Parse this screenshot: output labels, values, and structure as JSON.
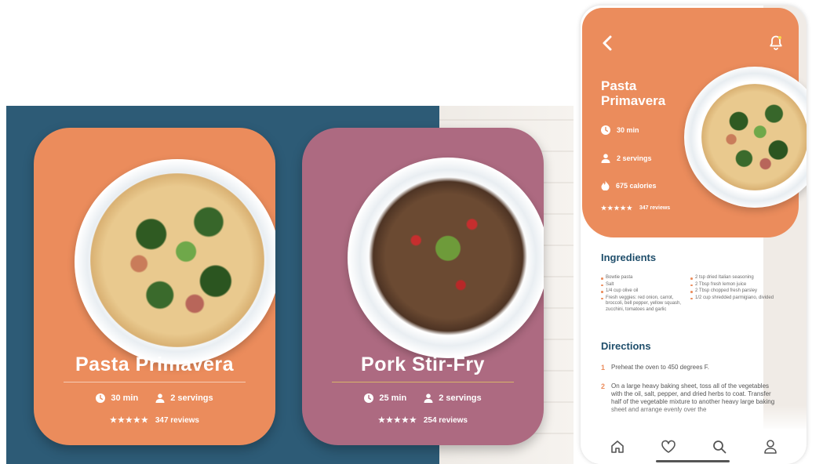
{
  "cards": [
    {
      "title": "Pasta Primavera",
      "time": "30 min",
      "servings": "2 servings",
      "stars": "★★★★★",
      "reviews": "347 reviews",
      "color": "#eb8c5c"
    },
    {
      "title": "Pork Stir-Fry",
      "time": "25 min",
      "servings": "2 servings",
      "stars": "★★★★★",
      "reviews": "254 reviews",
      "color": "#ad6a81"
    }
  ],
  "detail": {
    "title": "Pasta Primavera",
    "time": "30 min",
    "servings": "2 servings",
    "calories": "675 calories",
    "stars": "★★★★★",
    "reviews": "347 reviews",
    "ingredients_title": "Ingredients",
    "ingredients_left": [
      "Bowtie pasta",
      "Salt",
      "1/4 cup olive oil",
      "Fresh veggies: red onion, carrot, broccoli, bell pepper, yellow squash, zucchini, tomatoes and garlic"
    ],
    "ingredients_right": [
      "2 tsp dried Italian seasoning",
      "2 Tbsp fresh lemon juice",
      "2 Tbsp chopped fresh parsley",
      "1/2 cup shredded parmigiano, divided"
    ],
    "directions_title": "Directions",
    "directions": [
      {
        "num": "1",
        "text": "Preheat the oven to 450 degrees F."
      },
      {
        "num": "2",
        "text": "On a large heavy baking sheet, toss all of the vegetables with the oil, salt, pepper, and dried herbs to coat. Transfer half of the vegetable mixture to another heavy large baking sheet and arrange evenly over the"
      }
    ]
  },
  "colors": {
    "primary": "#eb8c5c",
    "secondary": "#ad6a81",
    "heading": "#1f4e6b",
    "panel": "#2d5b76"
  },
  "icons": {
    "back": "chevron-left-icon",
    "bell": "bell-icon",
    "clock": "clock-icon",
    "person": "person-icon",
    "flame": "flame-icon",
    "home": "home-icon",
    "heart": "heart-icon",
    "search": "search-icon",
    "profile": "profile-icon"
  }
}
